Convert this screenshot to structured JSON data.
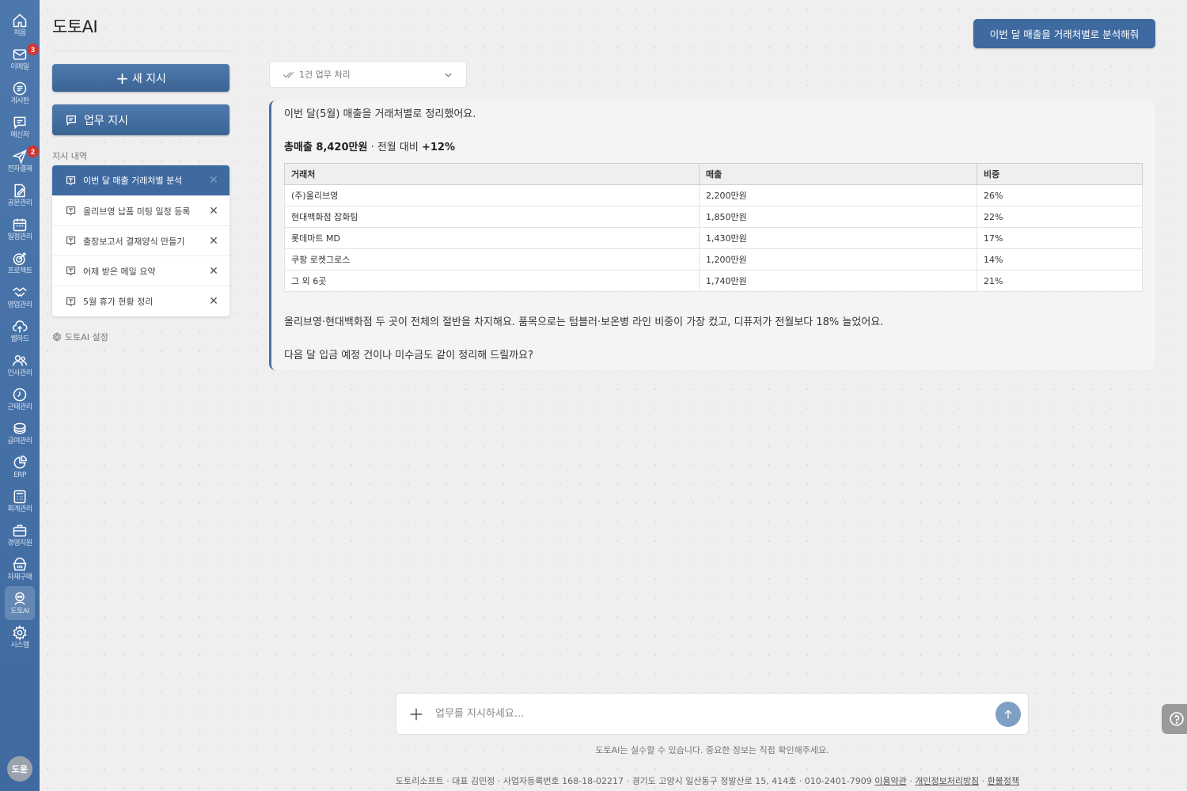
{
  "app": {
    "title": "도토AI"
  },
  "rail": {
    "items": [
      {
        "label": "처음",
        "icon": "home-icon",
        "badge": ""
      },
      {
        "label": "이메일",
        "icon": "mail-icon",
        "badge": "3"
      },
      {
        "label": "게시판",
        "icon": "board-icon",
        "badge": ""
      },
      {
        "label": "메신저",
        "icon": "messenger-icon",
        "badge": ""
      },
      {
        "label": "전자결재",
        "icon": "approval-icon",
        "badge": "2"
      },
      {
        "label": "공문관리",
        "icon": "document-icon",
        "badge": ""
      },
      {
        "label": "일정관리",
        "icon": "calendar-icon",
        "badge": ""
      },
      {
        "label": "프로젝트",
        "icon": "target-icon",
        "badge": ""
      },
      {
        "label": "영업관리",
        "icon": "handshake-icon",
        "badge": ""
      },
      {
        "label": "웹하드",
        "icon": "cloud-upload-icon",
        "badge": ""
      },
      {
        "label": "인사관리",
        "icon": "people-icon",
        "badge": ""
      },
      {
        "label": "근태관리",
        "icon": "clock-icon",
        "badge": ""
      },
      {
        "label": "급여관리",
        "icon": "coins-icon",
        "badge": ""
      },
      {
        "label": "ERP",
        "icon": "pie-chart-icon",
        "badge": ""
      },
      {
        "label": "회계관리",
        "icon": "calculator-icon",
        "badge": ""
      },
      {
        "label": "경영지원",
        "icon": "briefcase-icon",
        "badge": ""
      },
      {
        "label": "자재구매",
        "icon": "basket-icon",
        "badge": ""
      },
      {
        "label": "도토AI",
        "icon": "ai-bot-icon",
        "badge": "",
        "active": true
      },
      {
        "label": "시스템",
        "icon": "gear-icon",
        "badge": ""
      }
    ],
    "avatar": "도윤"
  },
  "panel": {
    "new_button": "새 지시",
    "task_button": "업무 지시",
    "history_label": "지시 내역",
    "history": [
      "이번 달 매출 거래처별 분석",
      "올리브영 납품 미팅 일정 등록",
      "출장보고서 결재양식 만들기",
      "어제 받은 메일 요약",
      "5월 휴가 현황 정리"
    ],
    "settings": "도토AI 설정"
  },
  "main": {
    "top_action": "이번 달 매출을 거래처별로 분석해줘",
    "task_dropdown": "1건 업무 처리",
    "answer": {
      "intro": "이번 달(5월) 매출을 거래처별로 정리했어요.",
      "total_label": "총매출 8,420만원",
      "compare_text": " · 전월 대비 ",
      "compare_value": "+12%",
      "table": {
        "headers": [
          "거래처",
          "매출",
          "비중"
        ],
        "rows": [
          [
            "(주)올리브영",
            "2,200만원",
            "26%"
          ],
          [
            "현대백화점 잡화팀",
            "1,850만원",
            "22%"
          ],
          [
            "롯데마트 MD",
            "1,430만원",
            "17%"
          ],
          [
            "쿠팡 로켓그로스",
            "1,200만원",
            "14%"
          ],
          [
            "그 외 6곳",
            "1,740만원",
            "21%"
          ]
        ]
      },
      "analysis": "올리브영·현대백화점 두 곳이 전체의 절반을 차지해요. 품목으로는 텀블러·보온병 라인 비중이 가장 컸고, 디퓨저가 전월보다 18% 늘었어요.",
      "question": "다음 달 입금 예정 건이나 미수금도 같이 정리해 드릴까요?"
    },
    "input_placeholder": "업무를 지시하세요...",
    "disclaimer": "도토AI는 실수할 수 있습니다. 중요한 정보는 직접 확인해주세요.",
    "footer": {
      "company": "도토리소프트 · 대표 김민정 · 사업자등록번호 168-18-02217 · 경기도 고양시 일산동구 정발산로 15, 414호 · 010-2401-7909 ",
      "terms": "이용약관",
      "sep1": " · ",
      "privacy": "개인정보처리방침",
      "sep2": " · ",
      "refund": "환불정책"
    }
  },
  "colors": {
    "accent": "#3f6aa0",
    "rail": "#4873a6",
    "badge": "#d23434"
  }
}
